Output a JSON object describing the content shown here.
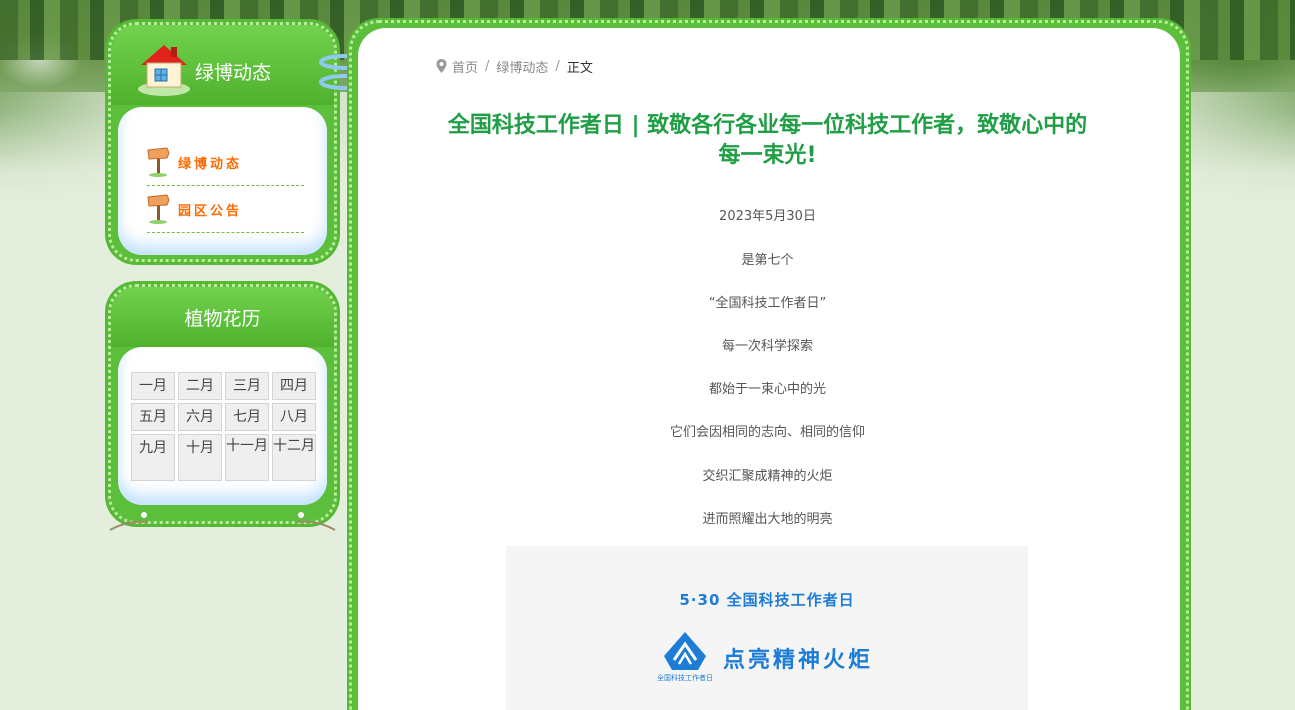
{
  "sidebar": {
    "news_panel": {
      "title": "绿博动态",
      "items": [
        {
          "label": "绿博动态",
          "icon": "signpost-icon"
        },
        {
          "label": "园区公告",
          "icon": "signpost-icon"
        }
      ]
    },
    "calendar_panel": {
      "title": "植物花历",
      "months": [
        "一月",
        "二月",
        "三月",
        "四月",
        "五月",
        "六月",
        "七月",
        "八月",
        "九月",
        "十月",
        "十一月",
        "十二月"
      ]
    }
  },
  "breadcrumb": {
    "icon": "location-pin-icon",
    "items": [
      "首页",
      "绿博动态",
      "正文"
    ]
  },
  "article": {
    "title": "全国科技工作者日 | 致敬各行各业每一位科技工作者，致敬心中的每一束光!",
    "paragraphs": [
      "2023年5月30日",
      "是第七个",
      "“全国科技工作者日”",
      "每一次科学探索",
      "都始于一束心中的光",
      "它们会因相同的志向、相同的信仰",
      "交织汇聚成精神的火炬",
      "进而照耀出大地的明亮"
    ],
    "poster": {
      "top_text": "5·30 全国科技工作者日",
      "logo_caption": "全国科技工作者日",
      "slogan": "点亮精神火炬"
    }
  },
  "colors": {
    "panel_green": "#5cbf3c",
    "title_green": "#1f9e45",
    "nav_orange": "#ff6a00",
    "poster_blue": "#1d7cd6"
  }
}
